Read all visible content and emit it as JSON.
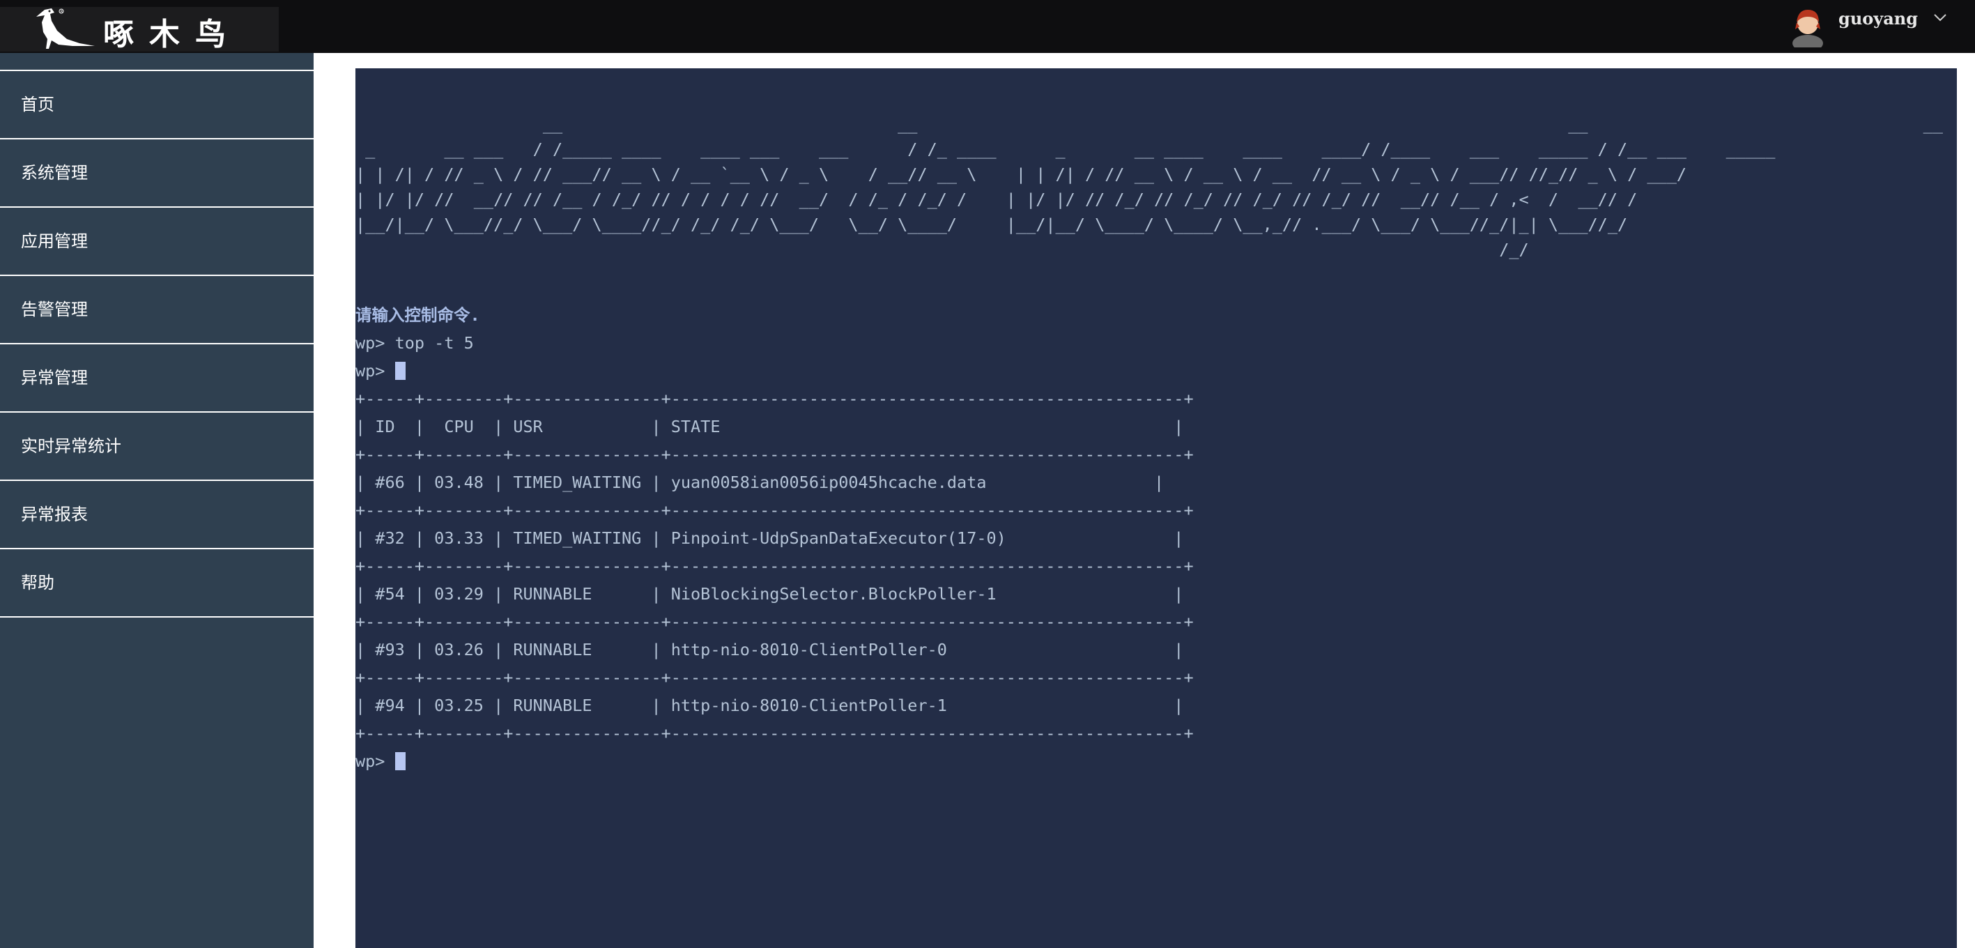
{
  "header": {
    "logo_text": "啄木鸟",
    "username": "guoyang",
    "avatar_icon": "user-avatar-icon",
    "dropdown_icon": "chevron-down-icon"
  },
  "sidebar": {
    "items": [
      {
        "label": "首页"
      },
      {
        "label": "系统管理"
      },
      {
        "label": "应用管理"
      },
      {
        "label": "告警管理"
      },
      {
        "label": "异常管理"
      },
      {
        "label": "实时异常统计"
      },
      {
        "label": "异常报表"
      },
      {
        "label": "帮助"
      }
    ]
  },
  "terminal": {
    "banner": [
      "                   __                                  __                                                                  __                                  __",
      " _       __ ___   / /_____ ____    ____ ___    ___      / /_ ____      _       __ ____    ____    ____/ /____    ___    _____ / /__ ___    _____",
      "| | /| / // _ \\ / // ___// __ \\ / __ `__ \\ / _ \\    / __// __ \\    | | /| / // __ \\ / __ \\ / __  // __ \\ / _ \\ / ___// //_// _ \\ / ___/",
      "| |/ |/ //  __// // /__ / /_/ // / / / / //  __/  / /_ / /_/ /    | |/ |/ // /_/ // /_/ // /_/ // /_/ //  __// /__ / ,<  /  __// /",
      "|__/|__/ \\___//_/ \\___/ \\____//_/ /_/ /_/ \\___/   \\__/ \\____/     |__/|__/ \\____/ \\____/ \\__,_// .___/ \\___/ \\___//_/|_| \\___//_/",
      "                                                                                                                    /_/"
    ],
    "hint": "请输入控制命令.",
    "prompt": "wp> ",
    "command": "top -t 5",
    "table": {
      "border": "+-----+--------+---------------+----------------------------------------------------+",
      "header": "| ID  |  CPU  | USR           | STATE                                              |",
      "rows": [
        "| #66 | 03.48 | TIMED_WAITING | yuan0058ian0056ip0045hcache.data                 |",
        "| #32 | 03.33 | TIMED_WAITING | Pinpoint-UdpSpanDataExecutor(17-0)                 |",
        "| #54 | 03.29 | RUNNABLE      | NioBlockingSelector.BlockPoller-1                  |",
        "| #93 | 03.26 | RUNNABLE      | http-nio-8010-ClientPoller-0                       |",
        "| #94 | 03.25 | RUNNABLE      | http-nio-8010-ClientPoller-1                       |"
      ]
    },
    "cursor_icon": "text-cursor-icon"
  }
}
